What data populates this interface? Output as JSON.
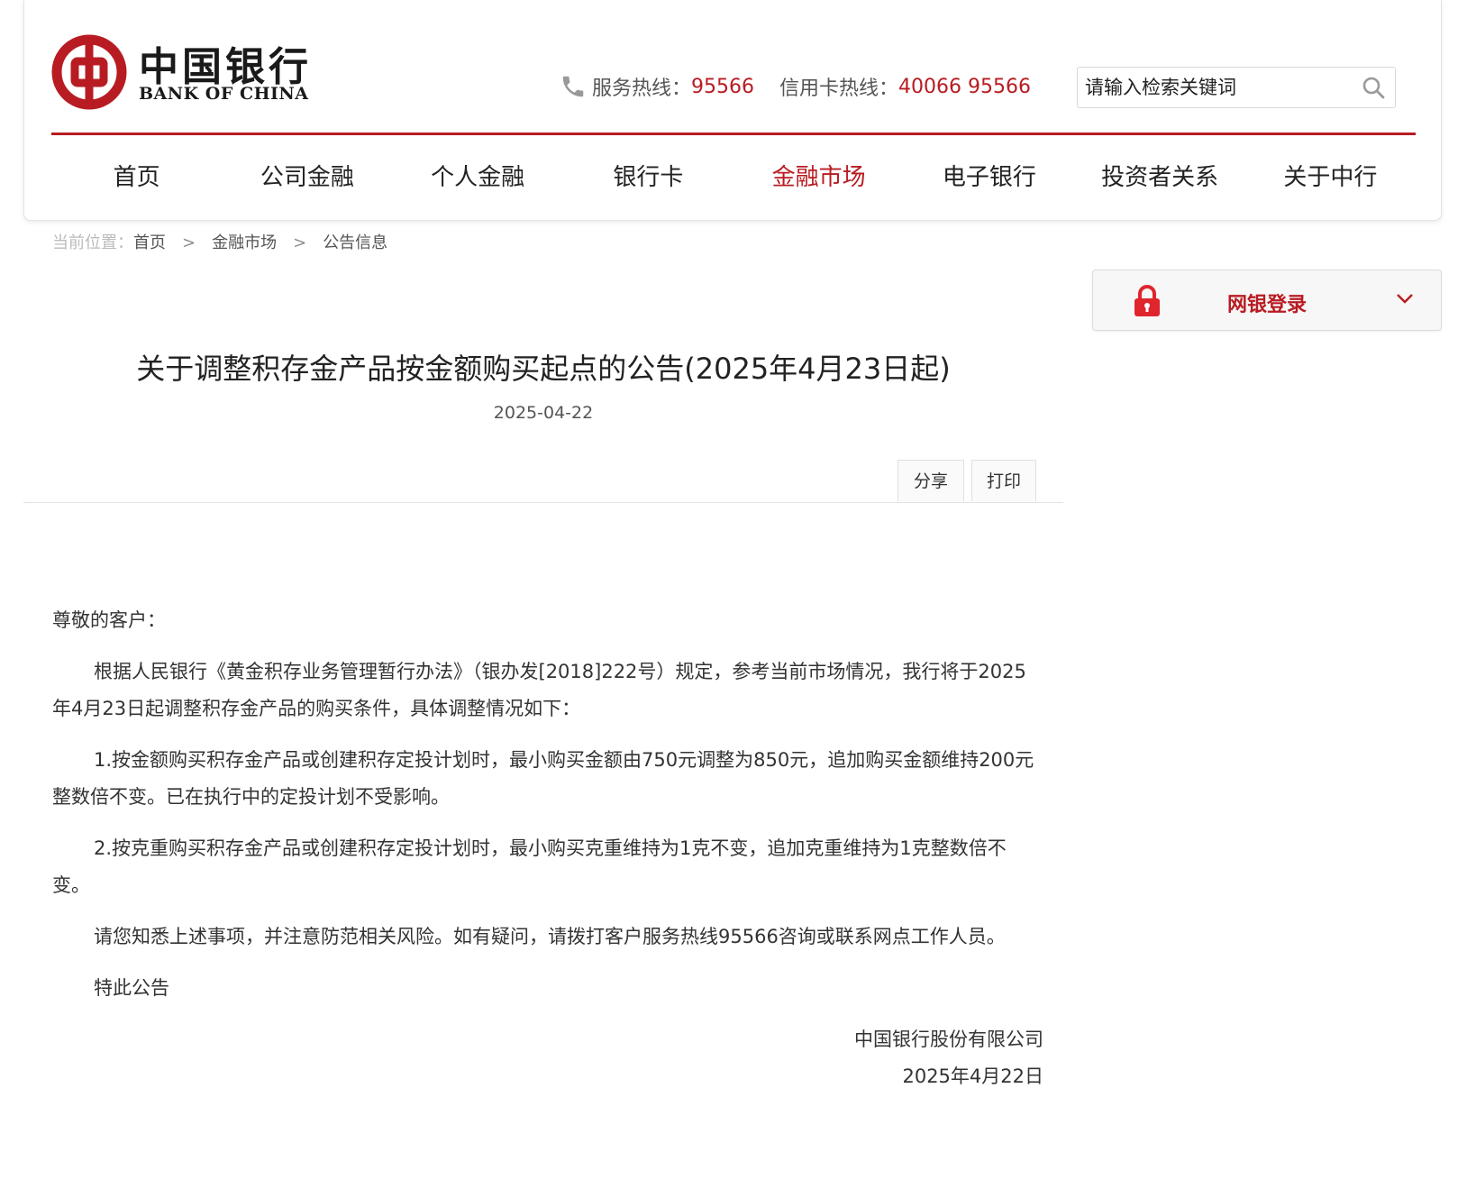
{
  "header": {
    "logo_cn": "中国银行",
    "logo_en": "BANK OF CHINA",
    "hotline_label": "服务热线：",
    "hotline_number": "95566",
    "card_hotline_label": "信用卡热线：",
    "card_hotline_number": "40066 95566",
    "search_placeholder": "请输入检索关键词"
  },
  "nav": {
    "items": [
      {
        "label": "首页"
      },
      {
        "label": "公司金融"
      },
      {
        "label": "个人金融"
      },
      {
        "label": "银行卡"
      },
      {
        "label": "金融市场",
        "active": true
      },
      {
        "label": "电子银行"
      },
      {
        "label": "投资者关系"
      },
      {
        "label": "关于中行"
      }
    ]
  },
  "breadcrumb": {
    "label": "当前位置：",
    "items": [
      "首页",
      "金融市场",
      "公告信息"
    ],
    "separator": ">"
  },
  "sidebar": {
    "login_label": "网银登录"
  },
  "article": {
    "title": "关于调整积存金产品按金额购买起点的公告(2025年4月23日起)",
    "date": "2025-04-22",
    "share_label": "分享",
    "print_label": "打印",
    "greeting": "尊敬的客户：",
    "paragraphs": [
      "根据人民银行《黄金积存业务管理暂行办法》（银办发[2018]222号）规定，参考当前市场情况，我行将于2025年4月23日起调整积存金产品的购买条件，具体调整情况如下：",
      "1.按金额购买积存金产品或创建积存定投计划时，最小购买金额由750元调整为850元，追加购买金额维持200元整数倍不变。已在执行中的定投计划不受影响。",
      "2.按克重购买积存金产品或创建积存定投计划时，最小购买克重维持为1克不变，追加克重维持为1克整数倍不变。",
      "请您知悉上述事项，并注意防范相关风险。如有疑问，请拨打客户服务热线95566咨询或联系网点工作人员。",
      "特此公告"
    ],
    "signature": "中国银行股份有限公司",
    "sign_date": "2025年4月22日"
  },
  "colors": {
    "brand_red": "#b81c22"
  }
}
